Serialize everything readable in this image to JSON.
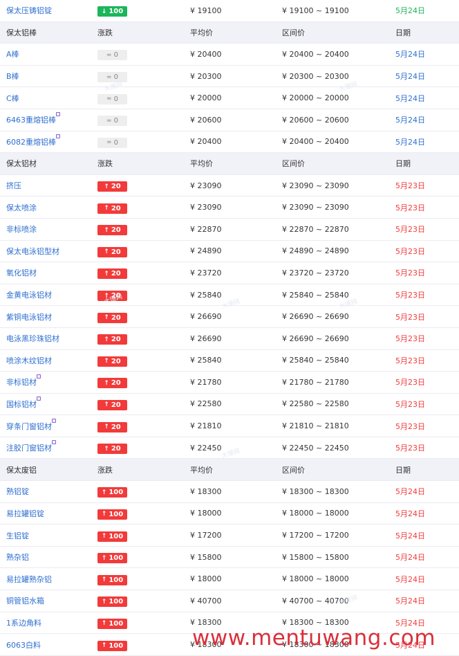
{
  "sections": [
    {
      "header": null,
      "rows": [
        {
          "name": "保太压铸铝锭",
          "direction": "down",
          "change": "100",
          "avg": "¥ 19100",
          "range": "¥ 19100 ~ 19100",
          "date": "5月24日",
          "date_color": "green",
          "tag": false
        }
      ]
    },
    {
      "header": {
        "name": "保太铝棒",
        "change": "涨跌",
        "avg": "平均价",
        "range": "区间价",
        "date": "日期"
      },
      "rows": [
        {
          "name": "A棒",
          "direction": "flat",
          "change": "0",
          "avg": "¥ 20400",
          "range": "¥ 20400 ~ 20400",
          "date": "5月24日",
          "date_color": "blue",
          "tag": false
        },
        {
          "name": "B棒",
          "direction": "flat",
          "change": "0",
          "avg": "¥ 20300",
          "range": "¥ 20300 ~ 20300",
          "date": "5月24日",
          "date_color": "blue",
          "tag": false
        },
        {
          "name": "C棒",
          "direction": "flat",
          "change": "0",
          "avg": "¥ 20000",
          "range": "¥ 20000 ~ 20000",
          "date": "5月24日",
          "date_color": "blue",
          "tag": false
        },
        {
          "name": "6463重熔铝棒",
          "direction": "flat",
          "change": "0",
          "avg": "¥ 20600",
          "range": "¥ 20600 ~ 20600",
          "date": "5月24日",
          "date_color": "blue",
          "tag": true
        },
        {
          "name": "6082重熔铝棒",
          "direction": "flat",
          "change": "0",
          "avg": "¥ 20400",
          "range": "¥ 20400 ~ 20400",
          "date": "5月24日",
          "date_color": "blue",
          "tag": true
        }
      ]
    },
    {
      "header": {
        "name": "保太铝材",
        "change": "涨跌",
        "avg": "平均价",
        "range": "区间价",
        "date": "日期"
      },
      "rows": [
        {
          "name": "挤压",
          "direction": "up",
          "change": "20",
          "avg": "¥ 23090",
          "range": "¥ 23090 ~ 23090",
          "date": "5月23日",
          "date_color": "red",
          "tag": false
        },
        {
          "name": "保太喷涂",
          "direction": "up",
          "change": "20",
          "avg": "¥ 23090",
          "range": "¥ 23090 ~ 23090",
          "date": "5月23日",
          "date_color": "red",
          "tag": false
        },
        {
          "name": "非标喷涂",
          "direction": "up",
          "change": "20",
          "avg": "¥ 22870",
          "range": "¥ 22870 ~ 22870",
          "date": "5月23日",
          "date_color": "red",
          "tag": false
        },
        {
          "name": "保太电泳铝型材",
          "direction": "up",
          "change": "20",
          "avg": "¥ 24890",
          "range": "¥ 24890 ~ 24890",
          "date": "5月23日",
          "date_color": "red",
          "tag": false
        },
        {
          "name": "氧化铝材",
          "direction": "up",
          "change": "20",
          "avg": "¥ 23720",
          "range": "¥ 23720 ~ 23720",
          "date": "5月23日",
          "date_color": "red",
          "tag": false
        },
        {
          "name": "金黄电泳铝材",
          "direction": "up",
          "change": "20",
          "avg": "¥ 25840",
          "range": "¥ 25840 ~ 25840",
          "date": "5月23日",
          "date_color": "red",
          "tag": false
        },
        {
          "name": "紫铜电泳铝材",
          "direction": "up",
          "change": "20",
          "avg": "¥ 26690",
          "range": "¥ 26690 ~ 26690",
          "date": "5月23日",
          "date_color": "red",
          "tag": false
        },
        {
          "name": "电泳黑珍珠铝材",
          "direction": "up",
          "change": "20",
          "avg": "¥ 26690",
          "range": "¥ 26690 ~ 26690",
          "date": "5月23日",
          "date_color": "red",
          "tag": false
        },
        {
          "name": "喷涂木纹铝材",
          "direction": "up",
          "change": "20",
          "avg": "¥ 25840",
          "range": "¥ 25840 ~ 25840",
          "date": "5月23日",
          "date_color": "red",
          "tag": false
        },
        {
          "name": "非标铝材",
          "direction": "up",
          "change": "20",
          "avg": "¥ 21780",
          "range": "¥ 21780 ~ 21780",
          "date": "5月23日",
          "date_color": "red",
          "tag": true
        },
        {
          "name": "国标铝材",
          "direction": "up",
          "change": "20",
          "avg": "¥ 22580",
          "range": "¥ 22580 ~ 22580",
          "date": "5月23日",
          "date_color": "red",
          "tag": true
        },
        {
          "name": "穿条门窗铝材",
          "direction": "up",
          "change": "20",
          "avg": "¥ 21810",
          "range": "¥ 21810 ~ 21810",
          "date": "5月23日",
          "date_color": "red",
          "tag": true
        },
        {
          "name": "注胶门窗铝材",
          "direction": "up",
          "change": "20",
          "avg": "¥ 22450",
          "range": "¥ 22450 ~ 22450",
          "date": "5月23日",
          "date_color": "red",
          "tag": true
        }
      ]
    },
    {
      "header": {
        "name": "保太废铝",
        "change": "涨跌",
        "avg": "平均价",
        "range": "区间价",
        "date": "日期"
      },
      "rows": [
        {
          "name": "熟铝锭",
          "direction": "up",
          "change": "100",
          "avg": "¥ 18300",
          "range": "¥ 18300 ~ 18300",
          "date": "5月24日",
          "date_color": "red",
          "tag": false
        },
        {
          "name": "易拉罐铝锭",
          "direction": "up",
          "change": "100",
          "avg": "¥ 18000",
          "range": "¥ 18000 ~ 18000",
          "date": "5月24日",
          "date_color": "red",
          "tag": false
        },
        {
          "name": "生铝锭",
          "direction": "up",
          "change": "100",
          "avg": "¥ 17200",
          "range": "¥ 17200 ~ 17200",
          "date": "5月24日",
          "date_color": "red",
          "tag": false
        },
        {
          "name": "熟杂铝",
          "direction": "up",
          "change": "100",
          "avg": "¥ 15800",
          "range": "¥ 15800 ~ 15800",
          "date": "5月24日",
          "date_color": "red",
          "tag": false
        },
        {
          "name": "易拉罐熟杂铝",
          "direction": "up",
          "change": "100",
          "avg": "¥ 18000",
          "range": "¥ 18000 ~ 18000",
          "date": "5月24日",
          "date_color": "red",
          "tag": false
        },
        {
          "name": "铜管铝水箱",
          "direction": "up",
          "change": "100",
          "avg": "¥ 40700",
          "range": "¥ 40700 ~ 40700",
          "date": "5月24日",
          "date_color": "red",
          "tag": false
        },
        {
          "name": "1系边角料",
          "direction": "up",
          "change": "100",
          "avg": "¥ 18300",
          "range": "¥ 18300 ~ 18300",
          "date": "5月24日",
          "date_color": "red",
          "tag": false
        },
        {
          "name": "6063白料",
          "direction": "up",
          "change": "100",
          "avg": "¥ 18300",
          "range": "¥ 18300 ~ 18300",
          "date": "5月24日",
          "date_color": "red",
          "tag": false
        }
      ]
    }
  ],
  "icons": {
    "up": "↑",
    "down": "↓",
    "flat": "≈"
  },
  "colors": {
    "up": "#f23a3a",
    "down": "#1cb55a",
    "link": "#2e6fd0",
    "header_bg": "#f1f1f8"
  },
  "watermark": {
    "tile_text": "大珊网",
    "site": "www.mentuwang.com"
  }
}
